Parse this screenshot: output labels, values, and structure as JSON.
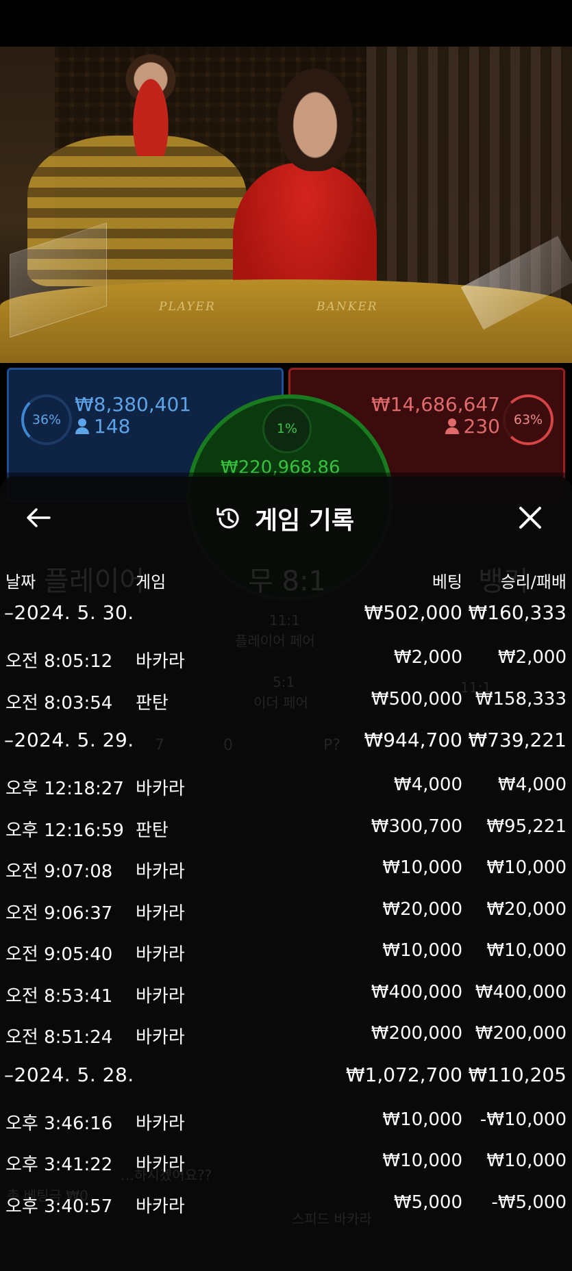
{
  "video": {
    "table_labels": [
      "PLAYER",
      "BANKER"
    ]
  },
  "bets": {
    "player": {
      "percent": "36%",
      "amount": "₩8,380,401",
      "players": "148"
    },
    "tie": {
      "percent": "1%",
      "amount": "₩220,968.86"
    },
    "banker": {
      "percent": "63%",
      "amount": "₩14,686,647",
      "players": "230"
    }
  },
  "sheet": {
    "title": "게임 기록",
    "columns": {
      "date": "날짜",
      "game": "게임",
      "bet": "베팅",
      "result": "승리/패배"
    },
    "rows": [
      {
        "type": "group",
        "date": "–2024. 5. 30.",
        "bet": "₩502,000",
        "result": "₩160,333"
      },
      {
        "type": "item",
        "date": "오전 8:05:12",
        "game": "바카라",
        "bet": "₩2,000",
        "result": "₩2,000"
      },
      {
        "type": "item",
        "date": "오전 8:03:54",
        "game": "판탄",
        "bet": "₩500,000",
        "result": "₩158,333"
      },
      {
        "type": "group",
        "date": "–2024. 5. 29.",
        "bet": "₩944,700",
        "result": "₩739,221"
      },
      {
        "type": "item",
        "date": "오후 12:18:27",
        "game": "바카라",
        "bet": "₩4,000",
        "result": "₩4,000"
      },
      {
        "type": "item",
        "date": "오후 12:16:59",
        "game": "판탄",
        "bet": "₩300,700",
        "result": "₩95,221"
      },
      {
        "type": "item",
        "date": "오전 9:07:08",
        "game": "바카라",
        "bet": "₩10,000",
        "result": "₩10,000"
      },
      {
        "type": "item",
        "date": "오전 9:06:37",
        "game": "바카라",
        "bet": "₩20,000",
        "result": "₩20,000"
      },
      {
        "type": "item",
        "date": "오전 9:05:40",
        "game": "바카라",
        "bet": "₩10,000",
        "result": "₩10,000"
      },
      {
        "type": "item",
        "date": "오전 8:53:41",
        "game": "바카라",
        "bet": "₩400,000",
        "result": "₩400,000"
      },
      {
        "type": "item",
        "date": "오전 8:51:24",
        "game": "바카라",
        "bet": "₩200,000",
        "result": "₩200,000"
      },
      {
        "type": "group",
        "date": "–2024. 5. 28.",
        "bet": "₩1,072,700",
        "result": "₩110,205"
      },
      {
        "type": "item",
        "date": "오후 3:46:16",
        "game": "바카라",
        "bet": "₩10,000",
        "result": "-₩10,000"
      },
      {
        "type": "item",
        "date": "오후 3:41:22",
        "game": "바카라",
        "bet": "₩10,000",
        "result": "₩10,000"
      },
      {
        "type": "item",
        "date": "오후 3:40:57",
        "game": "바카라",
        "bet": "₩5,000",
        "result": "-₩5,000"
      }
    ]
  },
  "background_ghost": {
    "player_label": "플레이어",
    "tie_label": "무 8:1",
    "banker_label": "뱅커",
    "pair_player_ratio": "11:1",
    "pair_player_label": "플레이어 페어",
    "either_pair_ratio": "5:1",
    "either_pair_label": "이더 페어",
    "right_ratio": "11:1",
    "count_a": "7",
    "count_b": "0",
    "p_label": "P?",
    "question_text": "…하시겠어요??",
    "total_bet": "총 베팅금 ₩0",
    "speed_label": "스피드 바카라"
  },
  "colors": {
    "player": "#1f4f94",
    "banker": "#9a2020",
    "tie": "#1a7a1f",
    "sheet_bg": "#0a0a0a"
  },
  "icons": {
    "back": "arrow-left-icon",
    "history": "history-clock-icon",
    "close": "close-icon",
    "user": "user-icon"
  }
}
